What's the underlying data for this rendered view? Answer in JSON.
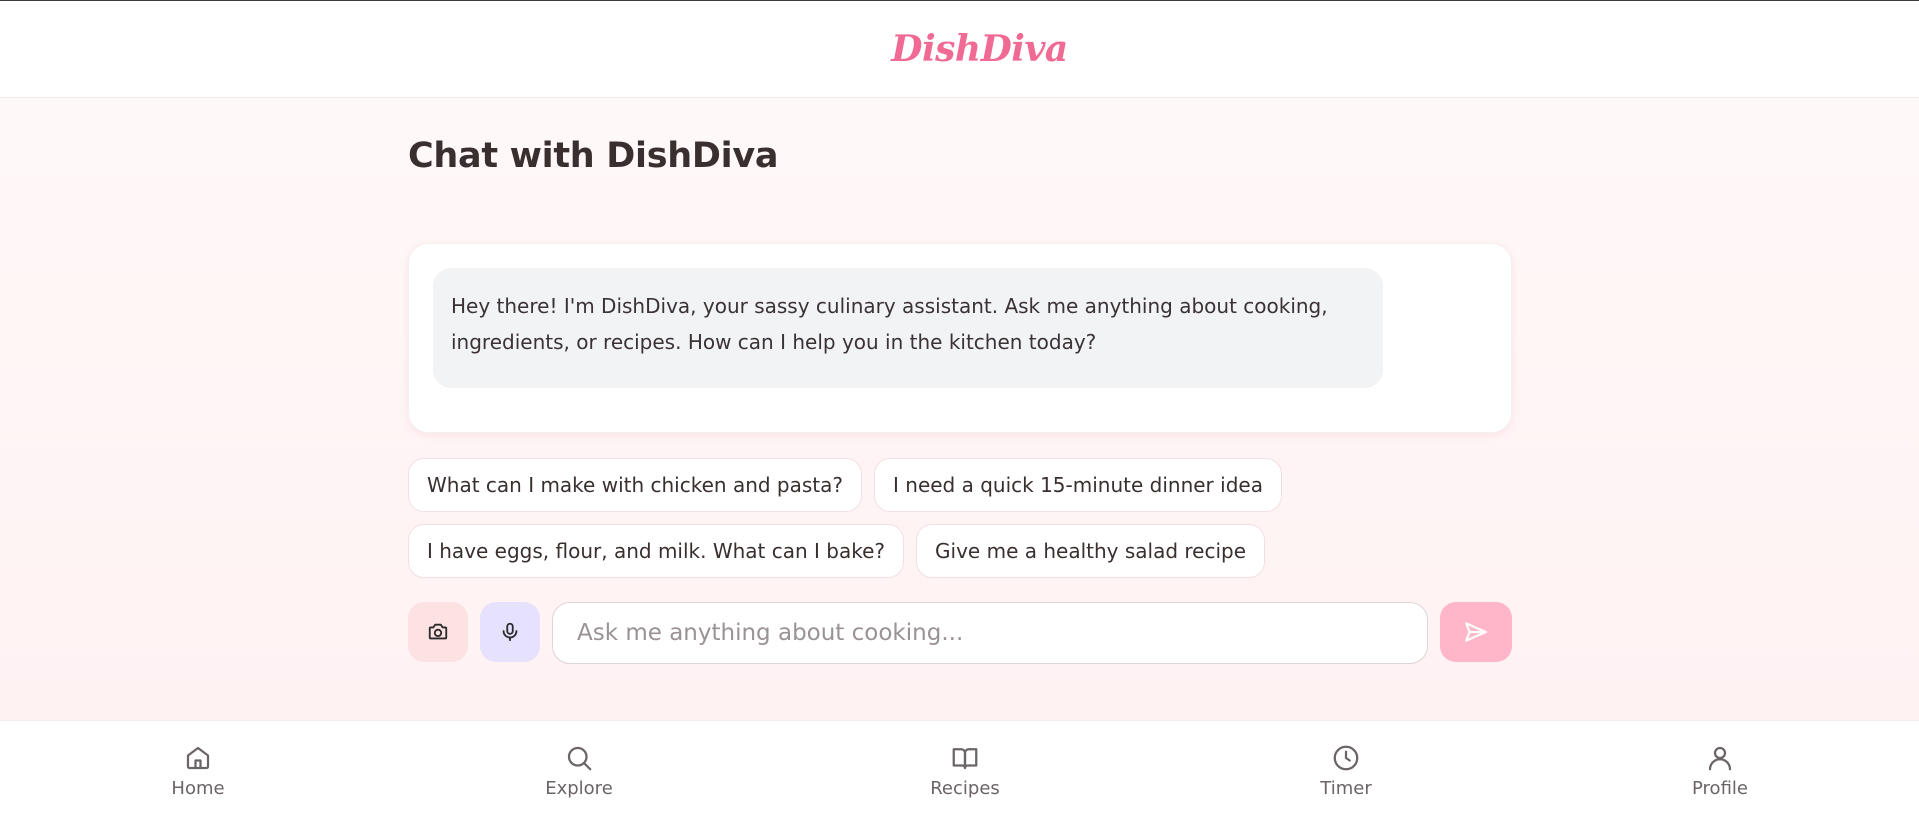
{
  "header": {
    "logo_text": "DishDiva",
    "brand_color": "#f06a94"
  },
  "main": {
    "page_title": "Chat with DishDiva",
    "messages": [
      {
        "sender": "assistant",
        "text": "Hey there! I'm DishDiva, your sassy culinary assistant. Ask me anything about cooking, ingredients, or recipes. How can I help you in the kitchen today?"
      }
    ],
    "suggestions": [
      "What can I make with chicken and pasta?",
      "I need a quick 15-minute dinner idea",
      "I have eggs, flour, and milk. What can I bake?",
      "Give me a healthy salad recipe"
    ],
    "input": {
      "placeholder": "Ask me anything about cooking...",
      "value": ""
    },
    "buttons": {
      "camera_icon": "camera-icon",
      "mic_icon": "microphone-icon",
      "send_icon": "send-icon"
    }
  },
  "bottom_nav": {
    "items": [
      {
        "label": "Home",
        "icon": "home-icon"
      },
      {
        "label": "Explore",
        "icon": "search-icon"
      },
      {
        "label": "Recipes",
        "icon": "book-icon"
      },
      {
        "label": "Timer",
        "icon": "clock-icon"
      },
      {
        "label": "Profile",
        "icon": "user-icon"
      }
    ]
  },
  "colors": {
    "camera_button_bg": "#fde2e4",
    "mic_button_bg": "#e6e2fd",
    "send_button_bg": "#ffb6c8",
    "assistant_bubble_bg": "#f2f3f5"
  }
}
